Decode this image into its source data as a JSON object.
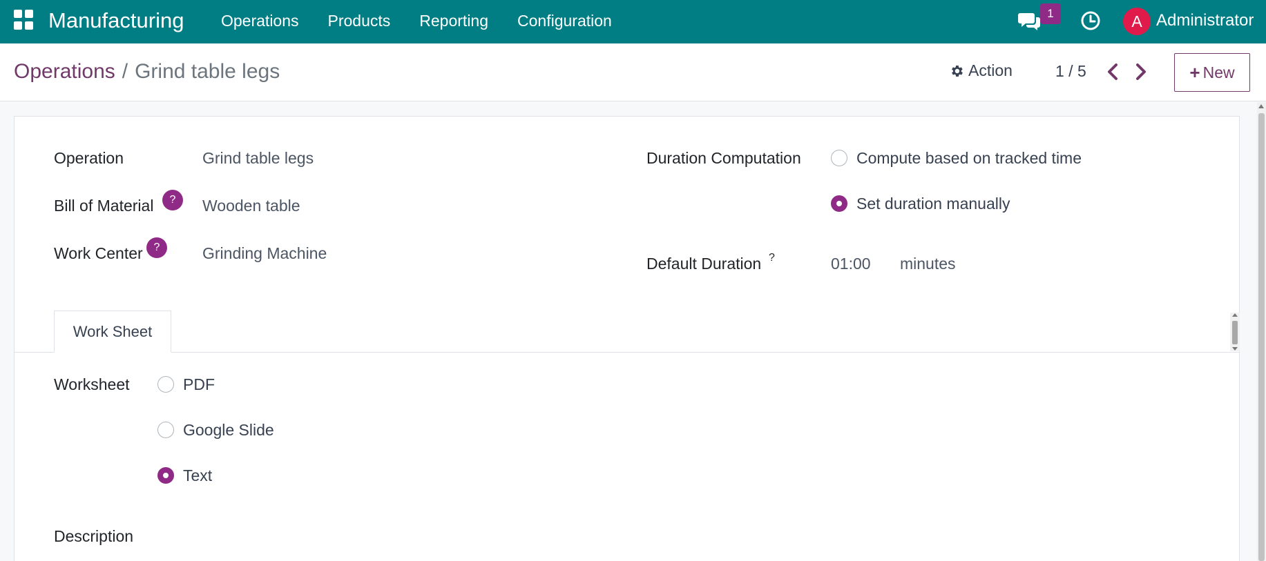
{
  "navbar": {
    "brand": "Manufacturing",
    "menu": [
      "Operations",
      "Products",
      "Reporting",
      "Configuration"
    ],
    "messages_count": "1",
    "avatar_letter": "A",
    "user_name": "Administrator",
    "icons": [
      "apps-icon",
      "chat-icon",
      "clock-icon"
    ]
  },
  "breadcrumb": {
    "parent": "Operations",
    "separator": "/",
    "current": "Grind table legs"
  },
  "control": {
    "action_label": "Action",
    "pager": "1 / 5",
    "new_label": "New"
  },
  "form": {
    "operation_label": "Operation",
    "operation_value": "Grind table legs",
    "bom_label": "Bill of Material",
    "bom_value": "Wooden table",
    "workcenter_label": "Work Center",
    "workcenter_value": "Grinding Machine",
    "help_mark": "?",
    "duration_computation_label": "Duration Computation",
    "duration_options": [
      {
        "label": "Compute based on tracked time",
        "checked": false
      },
      {
        "label": "Set duration manually",
        "checked": true
      }
    ],
    "default_duration_label": "Default Duration",
    "default_duration_value": "01:00",
    "default_duration_unit": "minutes"
  },
  "tabs": [
    "Work Sheet"
  ],
  "worksheet": {
    "label": "Worksheet",
    "options": [
      {
        "label": "PDF",
        "checked": false
      },
      {
        "label": "Google Slide",
        "checked": false
      },
      {
        "label": "Text",
        "checked": true
      }
    ],
    "description_label": "Description"
  },
  "colors": {
    "navbar": "#017e84",
    "primary": "#71396a",
    "accent": "#8f2a86",
    "avatar": "#e01b4b"
  }
}
